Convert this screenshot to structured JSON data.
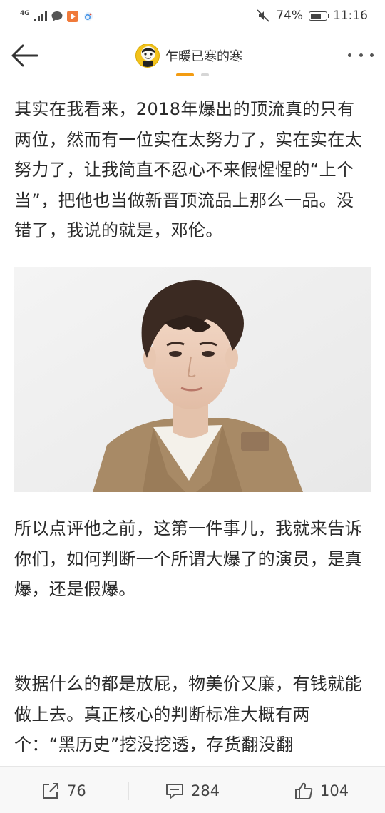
{
  "status_bar": {
    "network": "4G",
    "battery_percent": "74%",
    "battery_level": 0.74,
    "time": "11:16",
    "icons": [
      "signal-icon",
      "chat-bubble-icon",
      "video-app-icon",
      "weibo-app-icon",
      "mute-icon",
      "battery-icon"
    ]
  },
  "header": {
    "author_name": "乍暖已寒的寒",
    "icons": [
      "back-arrow-icon",
      "avatar",
      "more-dots-icon"
    ],
    "accent_color": "#f39c12"
  },
  "article": {
    "paragraphs": [
      "其实在我看来，2018年爆出的顶流真的只有两位，然而有一位实在太努力了，实在实在太努力了，让我简直不忍心不来假惺惺的“上个当”，把他也当做新晋顶流品上那么一品。没错了，我说的就是，邓伦。",
      "所以点评他之前，这第一件事儿，我就来告诉你们，如何判断一个所谓大爆了的演员，是真爆，还是假爆。",
      "数据什么的都是放屁，物美价又廉，有钱就能做上去。真正核心的判断标准大概有两个：“黑历史”挖没挖透，存货翻没翻"
    ]
  },
  "bottom_bar": {
    "share_count": "76",
    "comment_count": "284",
    "like_count": "104",
    "icons": [
      "share-icon",
      "comment-icon",
      "like-icon"
    ]
  }
}
